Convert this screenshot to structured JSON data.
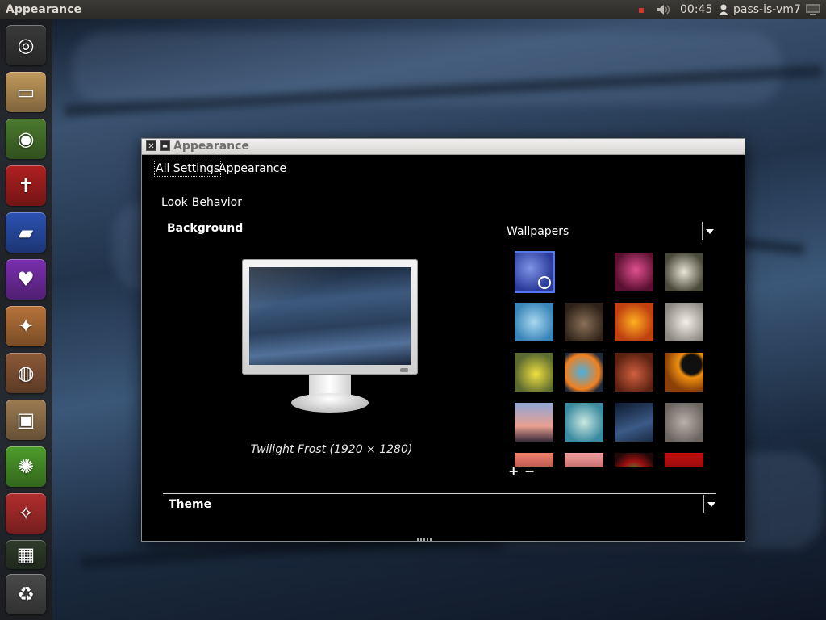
{
  "top_panel": {
    "app_title": "Appearance",
    "clock": "00:45",
    "user": "pass-is-vm7",
    "icons": [
      "notification-dot-icon",
      "volume-icon",
      "user-icon",
      "session-gear-icon"
    ]
  },
  "launcher": {
    "items": [
      {
        "name": "ubuntu-dash-icon",
        "color": "#3a3a3a",
        "glyph": "◎"
      },
      {
        "name": "home-folder-icon",
        "color": "#c29a5c",
        "glyph": "▭"
      },
      {
        "name": "chromium-browser-icon",
        "color": "#4b7a2e",
        "glyph": "◉"
      },
      {
        "name": "bible-reader-icon",
        "color": "#b02020",
        "glyph": "✝"
      },
      {
        "name": "bible-study-icon",
        "color": "#2b52b3",
        "glyph": "▰"
      },
      {
        "name": "christian-app-icon",
        "color": "#7a2fae",
        "glyph": "♥"
      },
      {
        "name": "puzzle-game-icon",
        "color": "#b8743a",
        "glyph": "✦"
      },
      {
        "name": "speaker-audio-icon",
        "color": "#8c5a38",
        "glyph": "◍"
      },
      {
        "name": "package-installer-icon",
        "color": "#9c7b52",
        "glyph": "▣"
      },
      {
        "name": "ubuntu-software-center-icon",
        "color": "#4e9d2b",
        "glyph": "✺"
      },
      {
        "name": "magic-wand-icon",
        "color": "#b32e2e",
        "glyph": "✧"
      },
      {
        "name": "workspace-switcher-icon",
        "color": "#2f3d2a",
        "glyph": "▦"
      },
      {
        "name": "trash-icon",
        "color": "#4a4a4a",
        "glyph": "♻"
      }
    ]
  },
  "window": {
    "title": "Appearance",
    "close_label": "✕",
    "minimize_label": "▬",
    "breadcrumb_all": "All Settings",
    "breadcrumb_current": "Appearance",
    "tabs": [
      "Look",
      "Behavior"
    ],
    "background_section": "Background",
    "background_caption": "Twilight Frost (1920 × 1280)",
    "wallpapers_label": "Wallpapers",
    "add_label": "+",
    "remove_label": "−",
    "theme_label": "Theme",
    "wallpapers": [
      {
        "name": "wallpaper-twilight-frost",
        "selected": true,
        "fill": "radial-gradient(circle at 40% 40%, #7f93e6, #2a3a9a 70%)"
      },
      {
        "name": "wallpaper-blank",
        "selected": false,
        "fill": "#000000"
      },
      {
        "name": "wallpaper-pink-flower",
        "selected": false,
        "fill": "radial-gradient(circle at 55% 45%, #e05090, #5a1030 70%)"
      },
      {
        "name": "wallpaper-white-blossom",
        "selected": false,
        "fill": "radial-gradient(circle at 50% 50%, #e8e4d6, #4a4a3a 75%)"
      },
      {
        "name": "wallpaper-blue-bubbles",
        "selected": false,
        "fill": "radial-gradient(circle at 50% 50%, #a8d8f0, #3a86b8 75%)"
      },
      {
        "name": "wallpaper-brown-sand",
        "selected": false,
        "fill": "radial-gradient(circle at 50% 55%, #8a7058, #2e2218 75%)"
      },
      {
        "name": "wallpaper-orange-flower",
        "selected": false,
        "fill": "radial-gradient(circle at 50% 50%, #ffb020, #c04010 70%)"
      },
      {
        "name": "wallpaper-white-clock",
        "selected": false,
        "fill": "radial-gradient(circle at 55% 50%, #f4f0e8, #8a8680 80%)"
      },
      {
        "name": "wallpaper-yellow-bloom",
        "selected": false,
        "fill": "radial-gradient(circle at 55% 55%, #f0e040, #5a6a30 70%)"
      },
      {
        "name": "wallpaper-cartoon-creature",
        "selected": false,
        "fill": "radial-gradient(circle at 45% 50%, #4ab0e0, #f08020 60%, #202a3a 80%)"
      },
      {
        "name": "wallpaper-red-bug",
        "selected": false,
        "fill": "radial-gradient(circle at 50% 55%, #d06040, #5a2010 75%)"
      },
      {
        "name": "wallpaper-orange-ring",
        "selected": false,
        "fill": "radial-gradient(circle at 70% 30%, #101010 25%, #f09010 35%, #8a4008 70%)"
      },
      {
        "name": "wallpaper-sunset-sky",
        "selected": false,
        "fill": "linear-gradient(#8fa6d8, #e8a090 60%, #3a2a3a)"
      },
      {
        "name": "wallpaper-teal-macro",
        "selected": false,
        "fill": "radial-gradient(circle at 50% 50%, #c8e8e0, #3a8aa0 75%)"
      },
      {
        "name": "wallpaper-blue-ice",
        "selected": false,
        "fill": "linear-gradient(160deg, #0d1a2e, #3b5a86 60%, #1a2a44)"
      },
      {
        "name": "wallpaper-grey-bokeh",
        "selected": false,
        "fill": "radial-gradient(circle at 50% 50%, #b8b0a8, #6a6460 80%)"
      },
      {
        "name": "wallpaper-coral-glow",
        "selected": false,
        "fill": "linear-gradient(#f08070, #6a1a1a)"
      },
      {
        "name": "wallpaper-pink-haze",
        "selected": false,
        "fill": "linear-gradient(#f0a0a0, #802020)"
      },
      {
        "name": "wallpaper-red-dragonfly",
        "selected": false,
        "fill": "radial-gradient(circle at 50% 50%, #40a040, #a01010 40%, #200808 80%)"
      },
      {
        "name": "wallpaper-crimson",
        "selected": false,
        "fill": "linear-gradient(#c01010, #600000)"
      }
    ]
  }
}
